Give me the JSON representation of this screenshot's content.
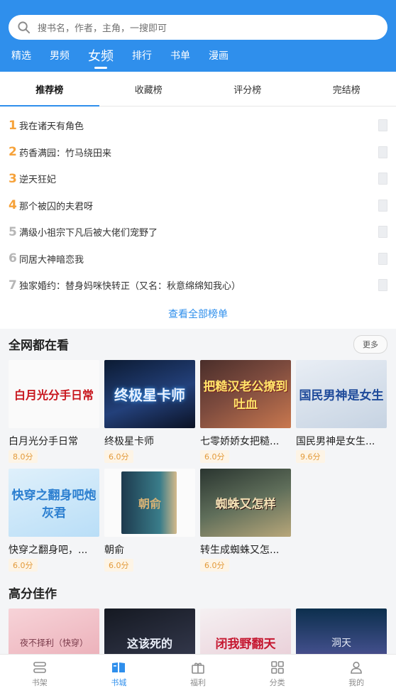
{
  "search": {
    "placeholder": "搜书名，作者，主角，一搜即可",
    "icon": "search-icon"
  },
  "channels": [
    {
      "label": "精选",
      "active": false
    },
    {
      "label": "男频",
      "active": false
    },
    {
      "label": "女频",
      "active": true
    },
    {
      "label": "排行",
      "active": false
    },
    {
      "label": "书单",
      "active": false
    },
    {
      "label": "漫画",
      "active": false
    }
  ],
  "rank_tabs": [
    {
      "label": "推荐榜",
      "active": true
    },
    {
      "label": "收藏榜",
      "active": false
    },
    {
      "label": "评分榜",
      "active": false
    },
    {
      "label": "完结榜",
      "active": false
    }
  ],
  "rank_list": [
    {
      "num": "1",
      "title": "我在诸天有角色"
    },
    {
      "num": "2",
      "title": "药香满园：竹马绕田来"
    },
    {
      "num": "3",
      "title": "逆天狂妃"
    },
    {
      "num": "4",
      "title": "那个被囚的夫君呀"
    },
    {
      "num": "5",
      "title": "满级小祖宗下凡后被大佬们宠野了"
    },
    {
      "num": "6",
      "title": "同居大神暗恋我"
    },
    {
      "num": "7",
      "title": "独家婚约：替身妈咪快转正（又名：秋意绵绵知我心）"
    }
  ],
  "see_all_label": "查看全部榜单",
  "section_watching": {
    "title": "全网都在看",
    "more_label": "更多",
    "books": [
      {
        "title": "白月光分手日常",
        "score": "8.0分",
        "cover_text": "白月光分手日常"
      },
      {
        "title": "终极星卡师",
        "score": "6.0分",
        "cover_text": "终极星卡师"
      },
      {
        "title": "七零娇娇女把糙...",
        "score": "6.0分",
        "cover_text": "把糙汉老公撩到吐血"
      },
      {
        "title": "国民男神是女生...",
        "score": "9.6分",
        "cover_text": "国民男神是女生"
      },
      {
        "title": "快穿之翻身吧，...",
        "score": "6.0分",
        "cover_text": "快穿之翻身吧炮灰君"
      },
      {
        "title": "朝俞",
        "score": "6.0分",
        "cover_text": "朝俞"
      },
      {
        "title": "转生成蜘蛛又怎...",
        "score": "6.0分",
        "cover_text": "蜘蛛又怎样"
      }
    ]
  },
  "section_high": {
    "title": "高分佳作",
    "books": [
      {
        "cover_text": "夜不择利（快穿）"
      },
      {
        "cover_text": "这该死的"
      },
      {
        "cover_text": "闭我野翻天"
      },
      {
        "cover_text": "洞天"
      }
    ]
  },
  "bottom_nav": [
    {
      "label": "书架",
      "icon": "bookshelf-icon",
      "active": false
    },
    {
      "label": "书城",
      "icon": "book-store-icon",
      "active": true
    },
    {
      "label": "福利",
      "icon": "gift-icon",
      "active": false
    },
    {
      "label": "分类",
      "icon": "category-grid-icon",
      "active": false
    },
    {
      "label": "我的",
      "icon": "user-icon",
      "active": false
    }
  ],
  "colors": {
    "accent": "#2f8fec",
    "rank_top": "#f6a23a",
    "rank_other": "#b6b6b6",
    "score": "#e39a3a"
  }
}
